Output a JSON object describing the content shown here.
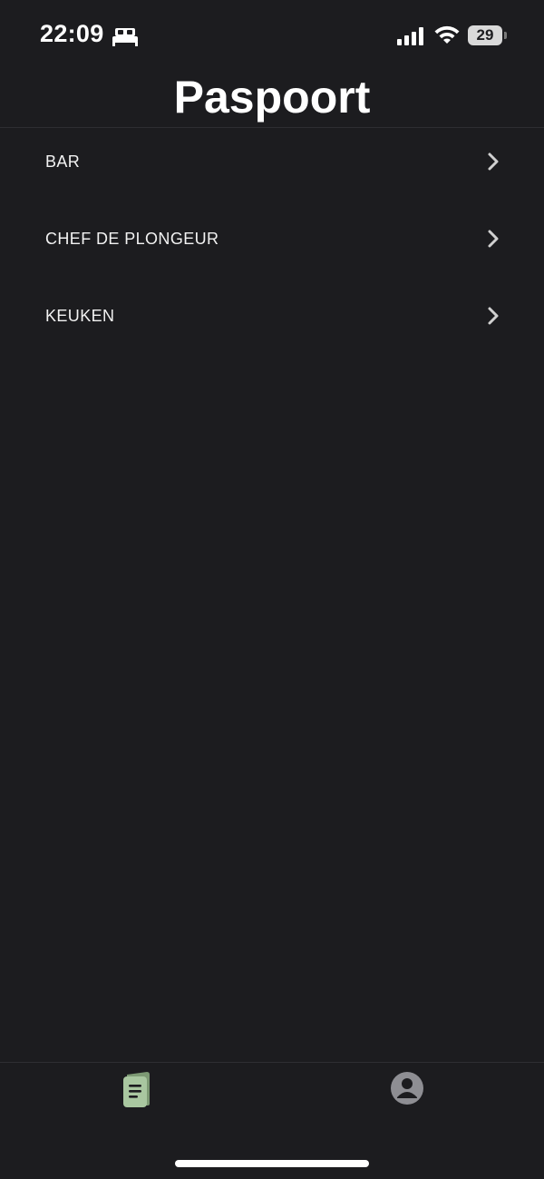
{
  "status_bar": {
    "time": "22:09",
    "battery_level": "29",
    "icons": [
      "sleep-icon",
      "signal-icon",
      "wifi-icon",
      "battery-icon"
    ]
  },
  "header": {
    "title": "Paspoort"
  },
  "list": {
    "items": [
      {
        "label": "BAR",
        "icon": "chevron-right-icon"
      },
      {
        "label": "CHEF DE PLONGEUR",
        "icon": "chevron-right-icon"
      },
      {
        "label": "KEUKEN",
        "icon": "chevron-right-icon"
      }
    ]
  },
  "tab_bar": {
    "tabs": [
      {
        "icon": "passport-document-icon",
        "active": true
      },
      {
        "icon": "profile-icon",
        "active": false
      }
    ]
  },
  "colors": {
    "background": "#1c1c1f",
    "text": "#ffffff",
    "active_tab": "#a9c7a0",
    "inactive_tab": "#8e8e93",
    "divider": "#2e2e32"
  }
}
